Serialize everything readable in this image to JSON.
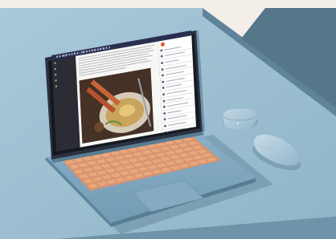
{
  "screen": {
    "page_title": "6 A SUP 4 5 B A / 5B A 3 B B U B N S 3",
    "nav_items": [
      {
        "icon": "folder-icon"
      },
      {
        "icon": "folder-icon"
      },
      {
        "icon": "folder-icon"
      },
      {
        "icon": "folder-icon"
      },
      {
        "icon": "folder-icon"
      }
    ],
    "article_text_lines": [
      0.98,
      0.94,
      0.97,
      0.9,
      0.95,
      0.88,
      0.93,
      0.6
    ],
    "side_items": [
      0.7,
      0.85,
      0.6,
      0.9,
      0.75,
      0.8,
      0.65,
      0.85,
      0.7,
      0.9,
      0.6,
      0.8,
      0.75,
      0.7
    ],
    "accent_colors": {
      "topbar": "#2a2f4f",
      "nav_bg": "#2c2c34",
      "nav_dot": "#8fd18b",
      "brand": "#e8523a"
    }
  },
  "scene": {
    "laptop_color": "#7fa6bf",
    "keycap_color": "#e8a87c",
    "peripherals": [
      "laptop",
      "wireless-earbuds-case",
      "wireless-mouse"
    ]
  }
}
